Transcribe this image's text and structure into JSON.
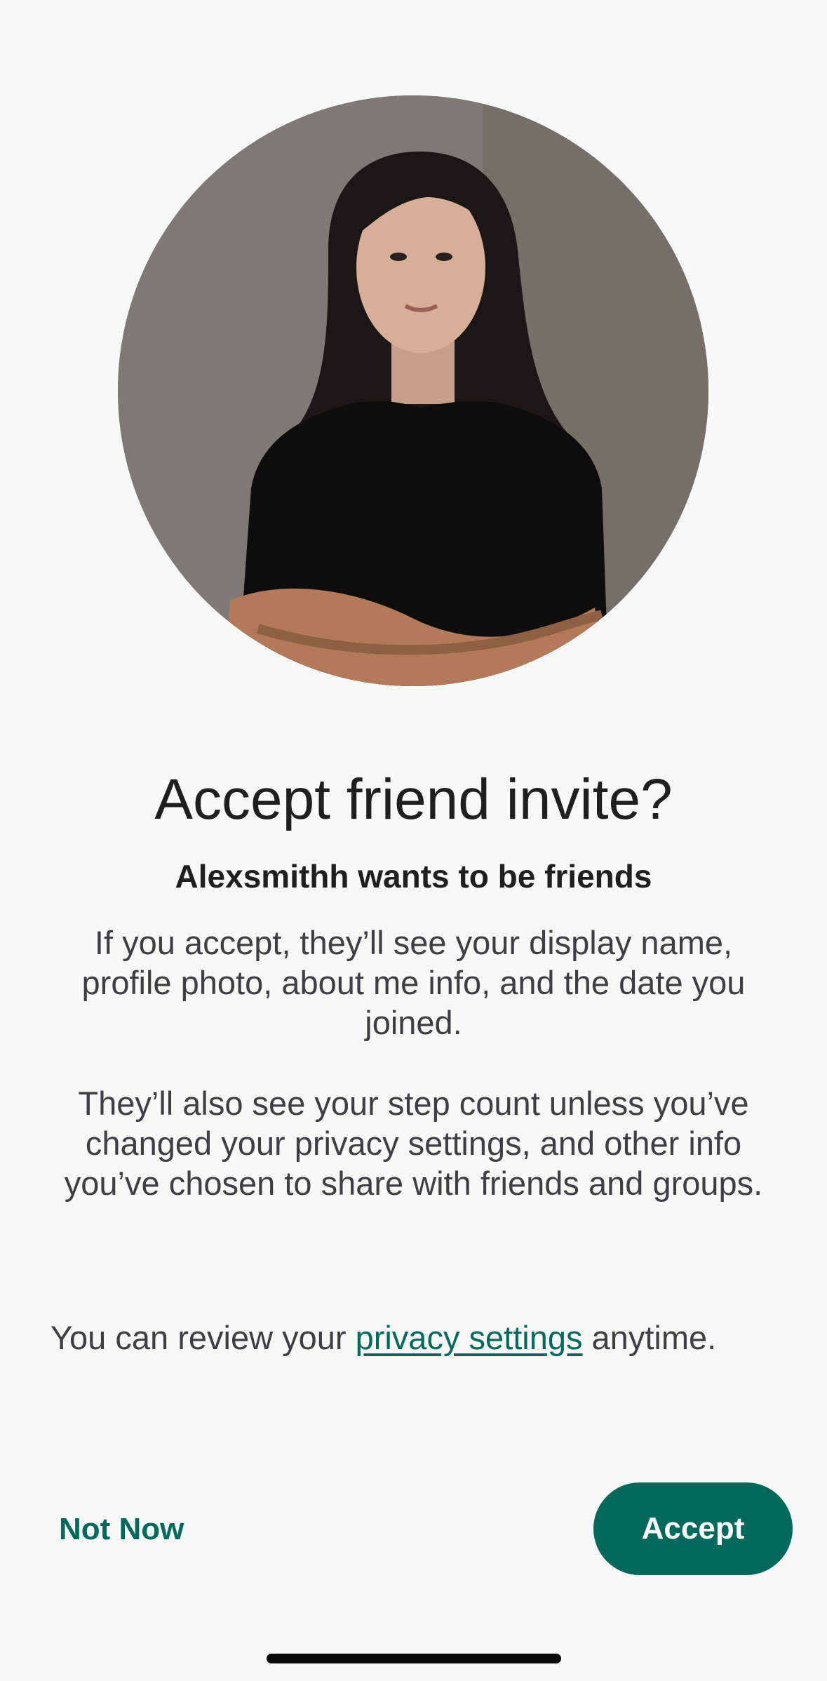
{
  "dialog": {
    "title": "Accept friend invite?",
    "subtitle": "Alexsmithh wants to be friends",
    "paragraph1": "If you accept, they’ll see your display name, profile photo, about me info, and the date you joined.",
    "paragraph2": "They’ll also see your step count unless you’ve changed your privacy settings, and other info you’ve chosen to share with friends and groups.",
    "review_prefix": "You can review your ",
    "review_link": "privacy settings",
    "review_suffix": " anytime."
  },
  "actions": {
    "not_now_label": "Not Now",
    "accept_label": "Accept"
  },
  "colors": {
    "accent": "#00695c",
    "background": "#f7f9f7",
    "text_primary": "#1f1f1f",
    "text_secondary": "#3c4043"
  }
}
